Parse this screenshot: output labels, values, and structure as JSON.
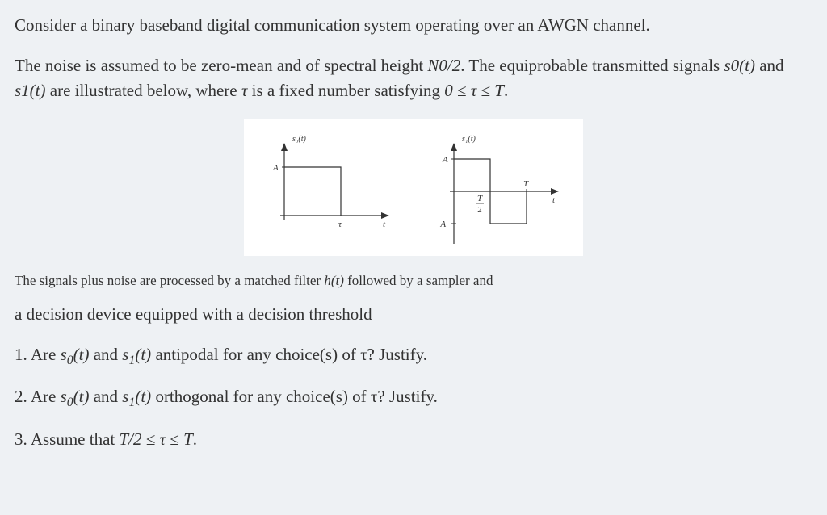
{
  "para1": "Consider a binary baseband digital communication system operating over an AWGN channel.",
  "para2_a": "The noise is assumed to be zero-mean and of spectral height ",
  "para2_no2": "N0/2",
  "para2_b": ". The equiprobable transmitted signals ",
  "para2_s0": "s0(t)",
  "para2_c": " and ",
  "para2_s1": "s1(t)",
  "para2_d": " are illustrated below, where ",
  "para2_tau": "τ",
  "para2_e": " is a fixed number satisfying ",
  "para2_range": "0 ≤ τ ≤ T",
  "para2_f": ".",
  "diagram": {
    "left_title": "s₀(t)",
    "right_title": "s₁(t)",
    "A_label": "A",
    "negA_label": "−A",
    "tau_label": "τ",
    "t_label": "t",
    "T_label": "T",
    "T2_label_top": "T",
    "T2_label_bot": "2"
  },
  "para3_a": "The signals plus noise are processed by a matched filter ",
  "para3_ht": "h(t)",
  "para3_b": " followed by a sampler and",
  "para4": "a decision device equipped with a decision threshold",
  "q1_a": "1. Are ",
  "q1_s0a": "s",
  "q1_s0b": "0",
  "q1_s0c": "(t)",
  "q1_b": " and ",
  "q1_s1a": "s",
  "q1_s1b": "1",
  "q1_s1c": "(t)",
  "q1_c": " antipodal for any choice(s) of τ? Justify.",
  "q2_a": "2. Are ",
  "q2_s0a": "s",
  "q2_s0b": "0",
  "q2_s0c": "(t)",
  "q2_b": " and ",
  "q2_s1a": "s",
  "q2_s1b": "1",
  "q2_s1c": "(t)",
  "q2_c": " orthogonal for any choice(s) of τ? Justify.",
  "q3_a": "3. Assume that ",
  "q3_b": "T/2 ≤ τ ≤ T",
  "q3_c": "."
}
